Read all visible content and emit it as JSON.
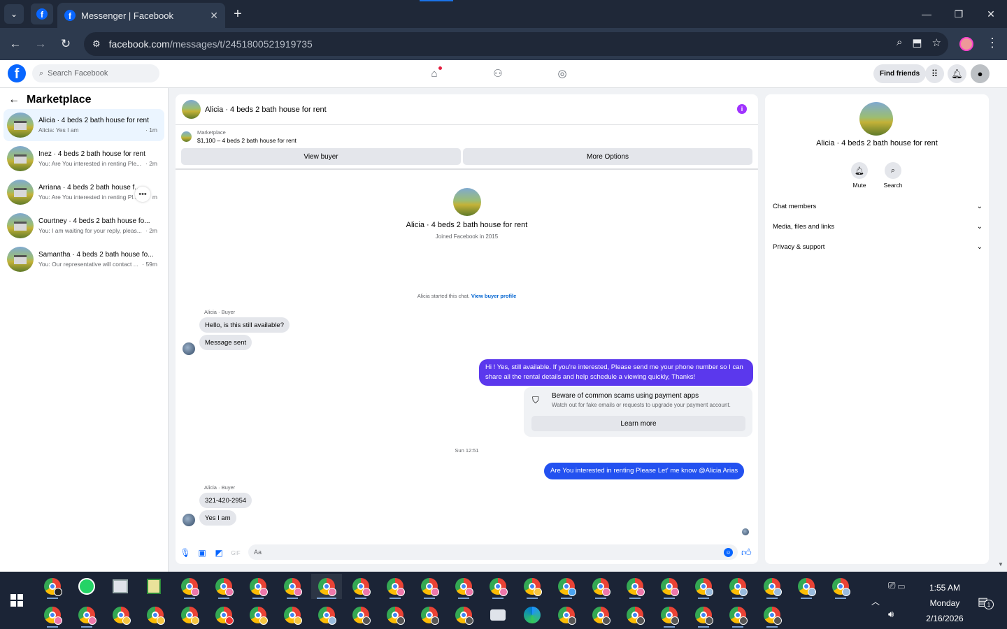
{
  "browser": {
    "tab_title": "Messenger | Facebook",
    "new_tab_label": "+",
    "url_host": "facebook.com",
    "url_path": "/messages/t/2451800521919735",
    "window_controls": {
      "minimize": "—",
      "restore": "❐",
      "close": "✕"
    },
    "nav": {
      "back": "←",
      "forward": "→",
      "reload": "↻"
    },
    "omnibox_icons": [
      "zoom-icon",
      "install-app-icon",
      "bookmark-star-icon"
    ]
  },
  "fb_nav": {
    "search_placeholder": "Search Facebook",
    "logo": "f",
    "find_friends_label": "Find friends",
    "icons": [
      "home-icon",
      "friends-icon",
      "groups-icon",
      "apps-grid-icon",
      "notifications-icon",
      "account-icon"
    ]
  },
  "sidebar": {
    "title": "Marketplace",
    "back_icon": "←",
    "conversations": [
      {
        "name": "Alicia · 4 beds 2 bath house for rent",
        "snippet": "Alicia: Yes I am",
        "time": " · 1m",
        "active": true
      },
      {
        "name": "Inez · 4 beds 2 bath house for rent",
        "snippet": "You: Are You interested in renting Ple...",
        "time": " · 2m",
        "active": false
      },
      {
        "name": "Arriana · 4 beds 2 bath house f...",
        "snippet": "You: Are You interested in renting Pl...",
        "time": "m",
        "active": false
      },
      {
        "name": "Courtney · 4 beds 2 bath house fo...",
        "snippet": "You: I am waiting for your reply, pleas...",
        "time": " · 2m",
        "active": false
      },
      {
        "name": "Samantha · 4 beds 2 bath house fo...",
        "snippet": "You: Our representative will contact ...",
        "time": " · 59m",
        "active": false
      }
    ],
    "more_options": "•••"
  },
  "chat": {
    "title": "Alicia · 4 beds 2 bath house for rent",
    "info_icon": "i",
    "listing_label": "Marketplace",
    "listing_detail": "$1,100 – 4 beds 2 bath house for rent",
    "view_buyer_label": "View buyer",
    "more_options_label": "More Options",
    "profile_name": "Alicia · 4 beds 2 bath house for rent",
    "profile_joined": "Joined Facebook in 2015",
    "started_text": "Alicia started this chat.",
    "view_buyer_profile": "View buyer profile",
    "sender_label_1": "Alicia · Buyer",
    "msg_in_1": "Hello, is this still available?",
    "msg_in_2": "Message sent",
    "msg_out_1": "Hi ! Yes, still available. If you're interested, Please send me your phone number so I can share all the rental details and help schedule a viewing quickly, Thanks!",
    "scam_title": "Beware of common scams using payment apps",
    "scam_sub": "Watch out for fake emails or requests to upgrade your payment account.",
    "learn_more": "Learn more",
    "timestamp": "Sun 12:51",
    "msg_out_2": "Are You  interested in renting Please Let' me know @Alicia Arias",
    "sender_label_2": "Alicia · Buyer",
    "msg_in_3": "321-420-2954",
    "msg_in_4": "Yes I am",
    "composer_placeholder": "Aa",
    "composer_icons": [
      "microphone-icon",
      "photo-icon",
      "sticker-icon",
      "gif-icon",
      "emoji-icon",
      "like-icon"
    ],
    "outgoing_color": "#5b38ed"
  },
  "right_panel": {
    "name": "Alicia · 4 beds 2 bath house for rent",
    "mute_label": "Mute",
    "search_label": "Search",
    "sections": [
      "Chat members",
      "Media, files and links",
      "Privacy & support"
    ]
  },
  "taskbar": {
    "time": "1:55 AM",
    "day": "Monday",
    "date": "2/16/2026",
    "notification_count": "1"
  }
}
